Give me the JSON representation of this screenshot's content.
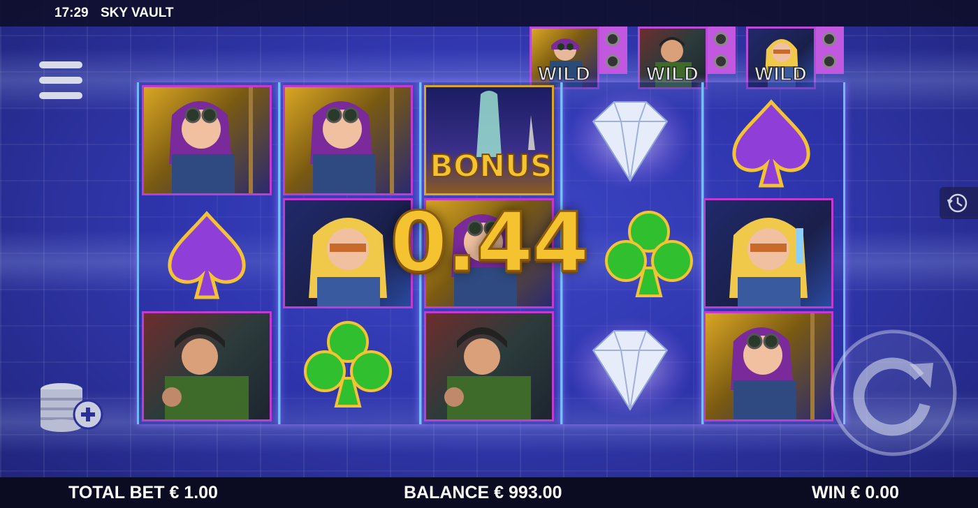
{
  "topbar": {
    "time": "17:29",
    "title": "SKY VAULT"
  },
  "wild_feature": {
    "label": "WILD"
  },
  "bonus_symbol": {
    "label": "BONUS"
  },
  "win_display": {
    "amount": "0.44"
  },
  "bottombar": {
    "total_bet": "TOTAL BET € 1.00",
    "balance": "BALANCE € 993.00",
    "win": "WIN € 0.00"
  },
  "reels": [
    [
      "spy-woman",
      "purple-spade",
      "thief-man"
    ],
    [
      "spy-woman",
      "blonde-woman",
      "green-club"
    ],
    [
      "bonus",
      "spy-woman",
      "thief-man"
    ],
    [
      "diamond",
      "green-club",
      "diamond"
    ],
    [
      "purple-spade",
      "blonde-woman",
      "spy-woman"
    ]
  ],
  "colors": {
    "accent_gold": "#f5c230",
    "spade_purple": "#8f3fd8",
    "club_green": "#2fbf2f",
    "frame_magenta": "#c23bd0",
    "reel_cyan": "#78c8ff"
  }
}
